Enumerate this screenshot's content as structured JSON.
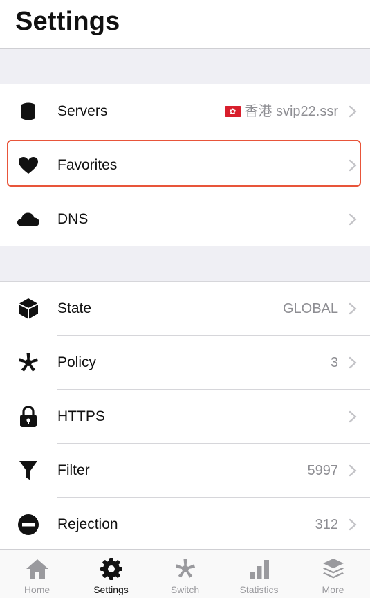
{
  "header": {
    "title": "Settings"
  },
  "group1": [
    {
      "key": "servers",
      "icon": "server-icon",
      "label": "Servers",
      "value": "香港 svip22.ssr",
      "flag": "hong-kong-flag-icon"
    },
    {
      "key": "favorites",
      "icon": "heart-icon",
      "label": "Favorites",
      "value": ""
    },
    {
      "key": "dns",
      "icon": "cloud-icon",
      "label": "DNS",
      "value": ""
    }
  ],
  "group2": [
    {
      "key": "state",
      "icon": "cube-icon",
      "label": "State",
      "value": "GLOBAL"
    },
    {
      "key": "policy",
      "icon": "asterisk-icon",
      "label": "Policy",
      "value": "3"
    },
    {
      "key": "https",
      "icon": "lock-icon",
      "label": "HTTPS",
      "value": ""
    },
    {
      "key": "filter",
      "icon": "funnel-icon",
      "label": "Filter",
      "value": "5997"
    },
    {
      "key": "rejection",
      "icon": "minus-circle-icon",
      "label": "Rejection",
      "value": "312"
    }
  ],
  "tabbar": {
    "items": [
      {
        "key": "home",
        "icon": "home-icon",
        "label": "Home",
        "active": false
      },
      {
        "key": "settings",
        "icon": "gear-icon",
        "label": "Settings",
        "active": true
      },
      {
        "key": "switch",
        "icon": "asterisk-icon",
        "label": "Switch",
        "active": false
      },
      {
        "key": "statistics",
        "icon": "bar-chart-icon",
        "label": "Statistics",
        "active": false
      },
      {
        "key": "more",
        "icon": "layers-icon",
        "label": "More",
        "active": false
      }
    ]
  },
  "colors": {
    "highlight": "#e8553a",
    "tab_active": "#111111",
    "tab_inactive": "#9a9a9e",
    "value_text": "#8e8e93"
  }
}
